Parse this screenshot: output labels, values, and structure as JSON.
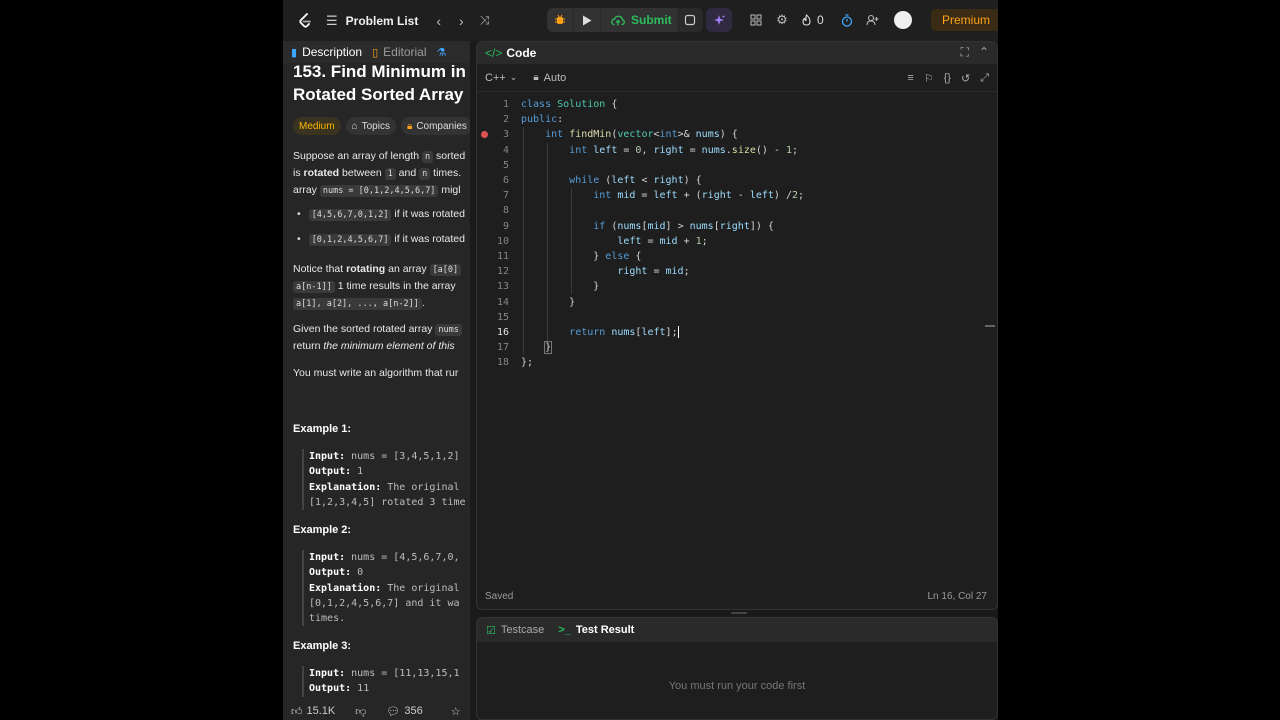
{
  "topbar": {
    "problem_list_label": "Problem List",
    "submit_label": "Submit",
    "streak_count": "0",
    "premium_label": "Premium"
  },
  "left_panel": {
    "tabs": [
      {
        "label": "Description",
        "icon": "description-icon"
      },
      {
        "label": "Editorial",
        "icon": "editorial-icon"
      }
    ],
    "title_line1": "153. Find Minimum in",
    "title_line2": "Rotated Sorted Array",
    "tags": [
      "Medium",
      "Topics",
      "Companies"
    ],
    "desc": {
      "p1_a": "Suppose an array of length ",
      "p1_code_n": "n",
      "p1_b": " sorted",
      "p2_a": "is ",
      "p2_bold": "rotated",
      "p2_b": " between ",
      "p2_code_1": "1",
      "p2_c": " and ",
      "p2_code_n": "n",
      "p2_d": " times.",
      "p3_a": "array ",
      "p3_code": "nums = [0,1,2,4,5,6,7]",
      "p3_b": " migl",
      "bullet1_code": "[4,5,6,7,0,1,2]",
      "bullet1_text": " if it was rotated",
      "bullet2_code": "[0,1,2,4,5,6,7]",
      "bullet2_text": " if it was rotated",
      "p4_a": "Notice that ",
      "p4_bold": "rotating",
      "p4_b": " an array ",
      "p4_code": "[a[0]",
      "p5_code": "a[n-1]]",
      "p5_b": " 1 time results in the array ",
      "p6_code": "a[1], a[2], ..., a[n-2]]",
      "p6_b": ".",
      "p7_a": "Given the sorted rotated array ",
      "p7_code": "nums",
      "p8_a": "return ",
      "p8_italic": "the minimum element of this",
      "p9": "You must write an algorithm that rur"
    },
    "examples": [
      {
        "title": "Example 1:",
        "input_label": "Input:",
        "input": " nums = [3,4,5,1,2]",
        "output_label": "Output:",
        "output": " 1",
        "expl_label": "Explanation:",
        "expl1": " The original",
        "expl2": "[1,2,3,4,5] rotated 3 time"
      },
      {
        "title": "Example 2:",
        "input_label": "Input:",
        "input": " nums = [4,5,6,7,0,",
        "output_label": "Output:",
        "output": " 0",
        "expl_label": "Explanation:",
        "expl1": " The original",
        "expl2": "[0,1,2,4,5,6,7] and it wa",
        "expl3": "times."
      },
      {
        "title": "Example 3:",
        "input_label": "Input:",
        "input": " nums = [11,13,15,1",
        "output_label": "Output:",
        "output": " 11"
      }
    ],
    "footer": {
      "likes": "15.1K",
      "comments": "356"
    }
  },
  "code_panel": {
    "title": "Code",
    "language": "C++",
    "mode": "Auto",
    "status_saved": "Saved",
    "cursor_pos": "Ln 16, Col 27",
    "lines": [
      "1",
      "2",
      "3",
      "4",
      "5",
      "6",
      "7",
      "8",
      "9",
      "10",
      "11",
      "12",
      "13",
      "14",
      "15",
      "16",
      "17",
      "18"
    ]
  },
  "test_panel": {
    "tab_testcase": "Testcase",
    "tab_result": "Test Result",
    "message": "You must run your code first"
  },
  "colors": {
    "accent_green": "#2cbb5d",
    "premium_orange": "#ffa116",
    "medium_yellow": "#ffb800"
  }
}
